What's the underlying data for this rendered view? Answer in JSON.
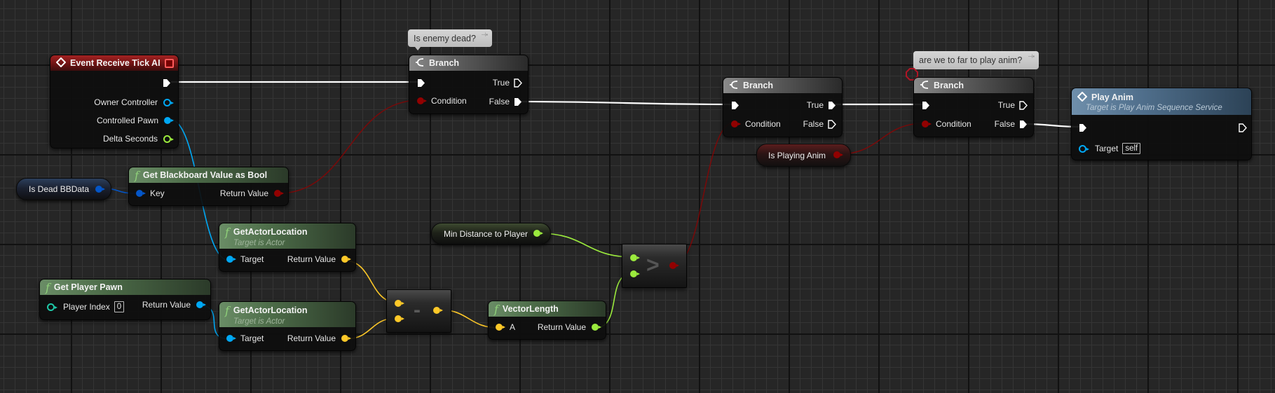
{
  "graph": {
    "colors": {
      "exec": "#ffffff",
      "bool": "#920101",
      "object": "#00a8f4",
      "vector": "#fdc828",
      "float": "#9bea3d",
      "blackboard_key": "#0456c8",
      "event_header": "#a32222",
      "function_header": "#6a8d66",
      "branch_header": "#8a8a8a",
      "playanim_header": "#6f8fab"
    },
    "nodes": {
      "event_tick": {
        "title": "Event Receive Tick AI",
        "pins": [
          "Owner Controller",
          "Controlled Pawn",
          "Delta Seconds"
        ]
      },
      "is_dead_var": {
        "label": "Is Dead BBData"
      },
      "get_bb_bool": {
        "title": "Get Blackboard Value as Bool",
        "input": "Key",
        "output": "Return Value"
      },
      "comment_1": {
        "text": "Is enemy dead?"
      },
      "branch_1": {
        "title": "Branch",
        "condition": "Condition",
        "true": "True",
        "false": "False"
      },
      "get_actor_loc_1": {
        "title": "GetActorLocation",
        "subtitle": "Target is Actor",
        "input": "Target",
        "output": "Return Value"
      },
      "get_player_pawn": {
        "title": "Get Player Pawn",
        "input": "Player Index",
        "input_value": "0",
        "output": "Return Value"
      },
      "get_actor_loc_2": {
        "title": "GetActorLocation",
        "subtitle": "Target is Actor",
        "input": "Target",
        "output": "Return Value"
      },
      "subtract": {
        "symbol": "-"
      },
      "vector_length": {
        "title": "VectorLength",
        "input": "A",
        "output": "Return Value"
      },
      "min_distance_var": {
        "label": "Min Distance to Player"
      },
      "greater": {
        "symbol": ">"
      },
      "branch_2": {
        "title": "Branch",
        "condition": "Condition",
        "true": "True",
        "false": "False"
      },
      "is_playing_var": {
        "label": "Is Playing Anim"
      },
      "comment_2": {
        "text": "are we to far to play anim?"
      },
      "branch_3": {
        "title": "Branch",
        "condition": "Condition",
        "true": "True",
        "false": "False"
      },
      "play_anim": {
        "title": "Play Anim",
        "subtitle": "Target is Play Anim Sequence Service",
        "input": "Target",
        "input_value": "self"
      }
    }
  }
}
